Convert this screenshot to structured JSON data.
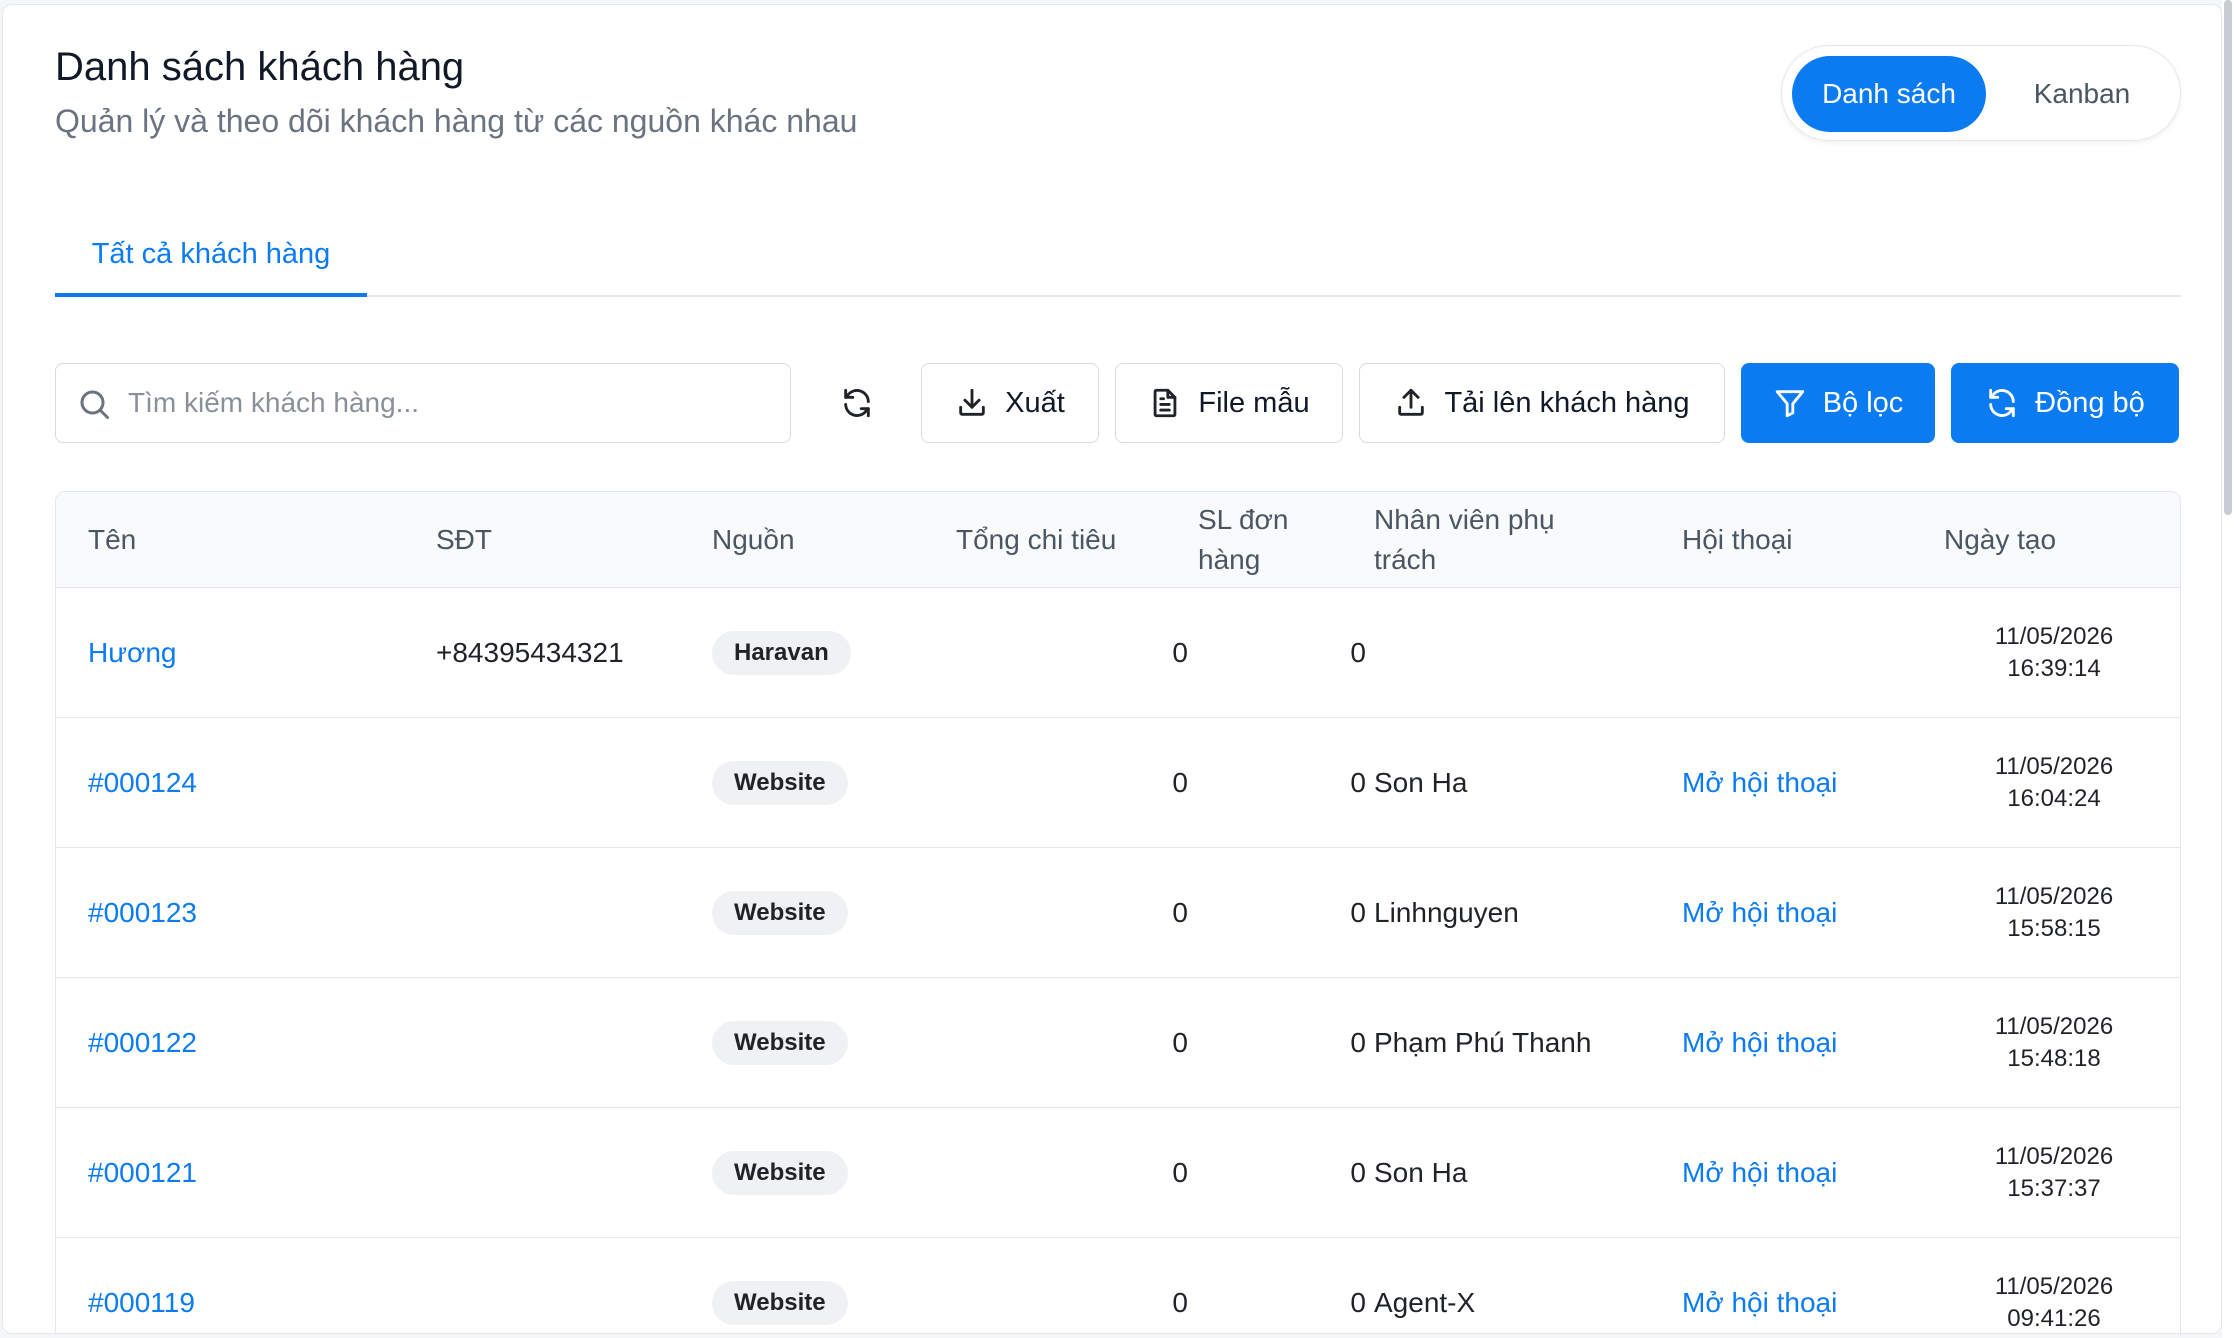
{
  "header": {
    "title": "Danh sách khách hàng",
    "subtitle": "Quản lý và theo dõi khách hàng từ các nguồn khác nhau"
  },
  "view_toggle": {
    "list_label": "Danh sách",
    "kanban_label": "Kanban",
    "selected": "Danh sách"
  },
  "tabs": {
    "all_customers": "Tất cả khách hàng"
  },
  "toolbar": {
    "search_placeholder": "Tìm kiếm khách hàng...",
    "export_label": "Xuất",
    "template_label": "File mẫu",
    "upload_label": "Tải lên khách hàng",
    "filter_label": "Bộ lọc",
    "sync_label": "Đồng bộ"
  },
  "table": {
    "columns": {
      "name": "Tên",
      "phone": "SĐT",
      "source": "Nguồn",
      "total_spend": "Tổng chi tiêu",
      "order_count": "SL đơn hàng",
      "staff": "Nhân viên phụ trách",
      "conversation": "Hội thoại",
      "created": "Ngày tạo"
    },
    "rows": [
      {
        "name": "Hương",
        "phone": "+84395434321",
        "source": "Haravan",
        "total_spend": "0",
        "order_count": "0",
        "staff": "",
        "conversation": "",
        "created_date": "11/05/2026",
        "created_time": "16:39:14"
      },
      {
        "name": "#000124",
        "phone": "",
        "source": "Website",
        "total_spend": "0",
        "order_count": "0",
        "staff": "Son Ha",
        "conversation": "Mở hội thoại",
        "created_date": "11/05/2026",
        "created_time": "16:04:24"
      },
      {
        "name": "#000123",
        "phone": "",
        "source": "Website",
        "total_spend": "0",
        "order_count": "0",
        "staff": "Linhnguyen",
        "conversation": "Mở hội thoại",
        "created_date": "11/05/2026",
        "created_time": "15:58:15"
      },
      {
        "name": "#000122",
        "phone": "",
        "source": "Website",
        "total_spend": "0",
        "order_count": "0",
        "staff": "Phạm Phú Thanh",
        "conversation": "Mở hội thoại",
        "created_date": "11/05/2026",
        "created_time": "15:48:18"
      },
      {
        "name": "#000121",
        "phone": "",
        "source": "Website",
        "total_spend": "0",
        "order_count": "0",
        "staff": "Son Ha",
        "conversation": "Mở hội thoại",
        "created_date": "11/05/2026",
        "created_time": "15:37:37"
      },
      {
        "name": "#000119",
        "phone": "",
        "source": "Website",
        "total_spend": "0",
        "order_count": "0",
        "staff": "Agent-X",
        "conversation": "Mở hội thoại",
        "created_date": "11/05/2026",
        "created_time": "09:41:26"
      }
    ]
  },
  "colors": {
    "primary": "#0b7bf2",
    "text": "#1f2328",
    "muted": "#6b7280",
    "border": "#e4e7ec"
  },
  "icons": {
    "search": "search-icon",
    "refresh": "refresh-icon",
    "export": "download-icon",
    "template": "file-icon",
    "upload": "upload-icon",
    "filter": "filter-icon",
    "sync": "sync-icon"
  }
}
